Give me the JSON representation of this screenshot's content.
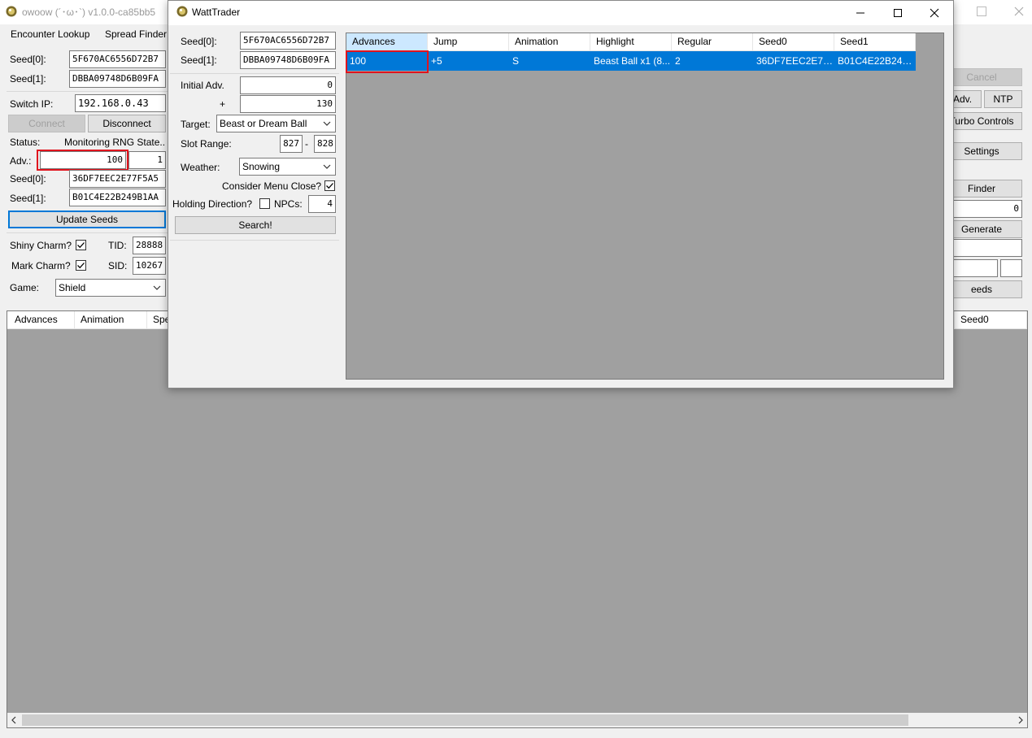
{
  "main": {
    "title": "owoow (´･ω･`) v1.0.0-ca85bb5",
    "menu": [
      "Encounter Lookup",
      "Spread Finder"
    ],
    "seed0_label": "Seed[0]:",
    "seed0_value": "5F670AC6556D72B7",
    "seed1_label": "Seed[1]:",
    "seed1_value": "DBBA09748D6B09FA",
    "switch_ip_label": "Switch IP:",
    "switch_ip_value": "192.168.0.43",
    "connect_label": "Connect",
    "disconnect_label": "Disconnect",
    "status_label": "Status:",
    "status_value": "Monitoring RNG State...",
    "adv_label": "Adv.:",
    "adv_value": "100",
    "adv_step": "1",
    "cur_seed0_label": "Seed[0]:",
    "cur_seed0_value": "36DF7EEC2E77F5A5",
    "cur_seed1_label": "Seed[1]:",
    "cur_seed1_value": "B01C4E22B249B1AA",
    "update_seeds_label": "Update Seeds",
    "shiny_charm_label": "Shiny Charm?",
    "mark_charm_label": "Mark Charm?",
    "tid_label": "TID:",
    "tid_value": "28888",
    "sid_label": "SID:",
    "sid_value": "10267",
    "game_label": "Game:",
    "game_value": "Shield",
    "grid_headers": [
      "Advances",
      "Animation",
      "Spe"
    ],
    "right_header": "Seed0",
    "right": {
      "cancel_label": "Cancel",
      "adv_label": "Adv.",
      "ntp_label": "NTP",
      "turbo_label": "Turbo Controls",
      "settings_label": "Settings",
      "finder_label": "Finder",
      "finder_value": "0",
      "generate_label": "Generate",
      "seeds_label": "eeds"
    }
  },
  "watt": {
    "title": "WattTrader",
    "seed0_label": "Seed[0]:",
    "seed0_value": "5F670AC6556D72B7",
    "seed1_label": "Seed[1]:",
    "seed1_value": "DBBA09748D6B09FA",
    "initial_adv_label": "Initial Adv.",
    "initial_adv_value": "0",
    "plus_label": "+",
    "plus_value": "130",
    "target_label": "Target:",
    "target_value": "Beast or Dream Ball",
    "slot_range_label": "Slot Range:",
    "slot_min": "827",
    "slot_dash": "-",
    "slot_max": "828",
    "weather_label": "Weather:",
    "weather_value": "Snowing",
    "menu_close_label": "Consider Menu Close?",
    "holding_label": "Holding Direction?",
    "npcs_label": "NPCs:",
    "npcs_value": "4",
    "search_label": "Search!",
    "headers": [
      "Advances",
      "Jump",
      "Animation",
      "Highlight",
      "Regular",
      "Seed0",
      "Seed1"
    ],
    "rows": [
      [
        "100",
        "+5",
        "S",
        "Beast Ball x1 (8...",
        "2",
        "36DF7EEC2E77F...",
        "B01C4E22B249B..."
      ]
    ]
  },
  "colors": {
    "selection": "#0078d7",
    "highlight_box": "#e0141e",
    "grid_background": "#a0a0a0"
  }
}
